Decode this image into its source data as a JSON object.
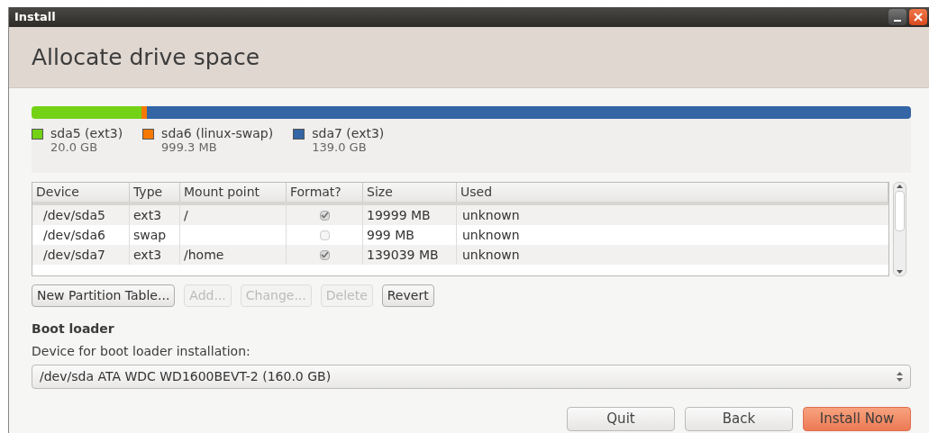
{
  "window": {
    "title": "Install"
  },
  "header": {
    "title": "Allocate drive space"
  },
  "partitions": [
    {
      "name": "sda5 (ext3)",
      "size": "20.0 GB",
      "color": "#73d216",
      "level": 0.125
    },
    {
      "name": "sda6 (linux-swap)",
      "size": "999.3 MB",
      "color": "#f57900",
      "level": 0.006
    },
    {
      "name": "sda7 (ext3)",
      "size": "139.0 GB",
      "color": "#3465a4",
      "level": 0.869
    }
  ],
  "table": {
    "columns": [
      "Device",
      "Type",
      "Mount point",
      "Format?",
      "Size",
      "Used"
    ],
    "rows": [
      {
        "device": "/dev/sda5",
        "type": "ext3",
        "mount_point": "/",
        "format": true,
        "size": "19999 MB",
        "used": "unknown"
      },
      {
        "device": "/dev/sda6",
        "type": "swap",
        "mount_point": "",
        "format": false,
        "size": "999 MB",
        "used": "unknown"
      },
      {
        "device": "/dev/sda7",
        "type": "ext3",
        "mount_point": "/home",
        "format": true,
        "size": "139039 MB",
        "used": "unknown"
      }
    ]
  },
  "table_buttons": [
    {
      "label": "New Partition Table...",
      "disabled": false
    },
    {
      "label": "Add...",
      "disabled": true
    },
    {
      "label": "Change...",
      "disabled": true
    },
    {
      "label": "Delete",
      "disabled": true
    },
    {
      "label": "Revert",
      "disabled": false
    }
  ],
  "boot_loader": {
    "heading": "Boot loader",
    "label": "Device for boot loader installation:",
    "value": "/dev/sda ATA WDC WD1600BEVT-2 (160.0 GB)"
  },
  "buttons": [
    {
      "label": "Quit",
      "kind": "normal"
    },
    {
      "label": "Back",
      "kind": "normal"
    },
    {
      "label": "Install Now",
      "kind": "primary"
    }
  ]
}
